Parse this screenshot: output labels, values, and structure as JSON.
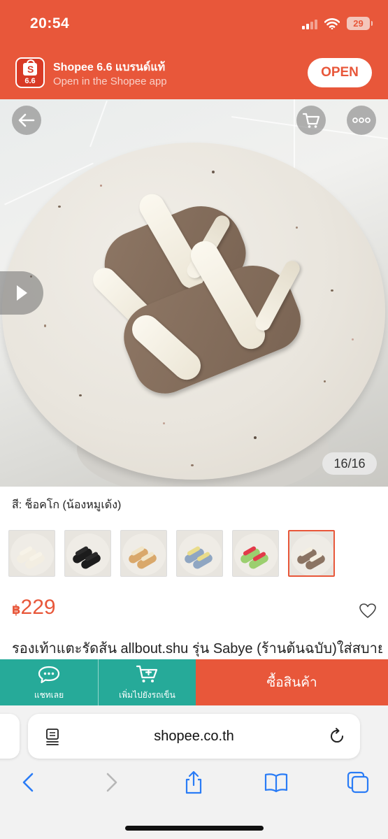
{
  "status_bar": {
    "time": "20:54",
    "battery": "29",
    "signal_icon": "cellular-signal-icon",
    "wifi_icon": "wifi-icon"
  },
  "app_banner": {
    "app_name": "Shopee 6.6 แบรนด์แท้",
    "subtitle": "Open in the Shopee app",
    "open_label": "OPEN",
    "logo_label": "6.6",
    "logo_letter": "S"
  },
  "product_image": {
    "counter": "16/16",
    "icons": [
      "back-arrow-icon",
      "cart-icon",
      "more-icon",
      "play-icon"
    ]
  },
  "variant": {
    "label": "สี: ช็อคโก (น้องหมูเด้ง)",
    "thumbnails": [
      {
        "sole": "#f3eee2",
        "strap": "#f7f3e8"
      },
      {
        "sole": "#1c1c1c",
        "strap": "#2a2a2a"
      },
      {
        "sole": "#d9a86b",
        "strap": "#f1e5c8"
      },
      {
        "sole": "#8fa6c2",
        "strap": "#e9dc8a"
      },
      {
        "sole": "#9bcf6f",
        "strap": "#e23a4a"
      },
      {
        "sole": "#8b7463",
        "strap": "#f4efe2"
      }
    ],
    "selected_index": 5
  },
  "price": {
    "currency": "฿",
    "amount": "229"
  },
  "title": "รองเท้าแตะรัดส้น allbout.shu รุ่น Sabye (ร้านต้นฉบับ)ใส่สบาย",
  "action_bar": {
    "chat_label": "แชทเลย",
    "add_cart_label": "เพิ่มไปยังรถเข็น",
    "buy_label": "ซื้อสินค้า"
  },
  "safari": {
    "url": "shopee.co.th"
  },
  "colors": {
    "brand": "#e8573a",
    "green": "#26aa99"
  }
}
